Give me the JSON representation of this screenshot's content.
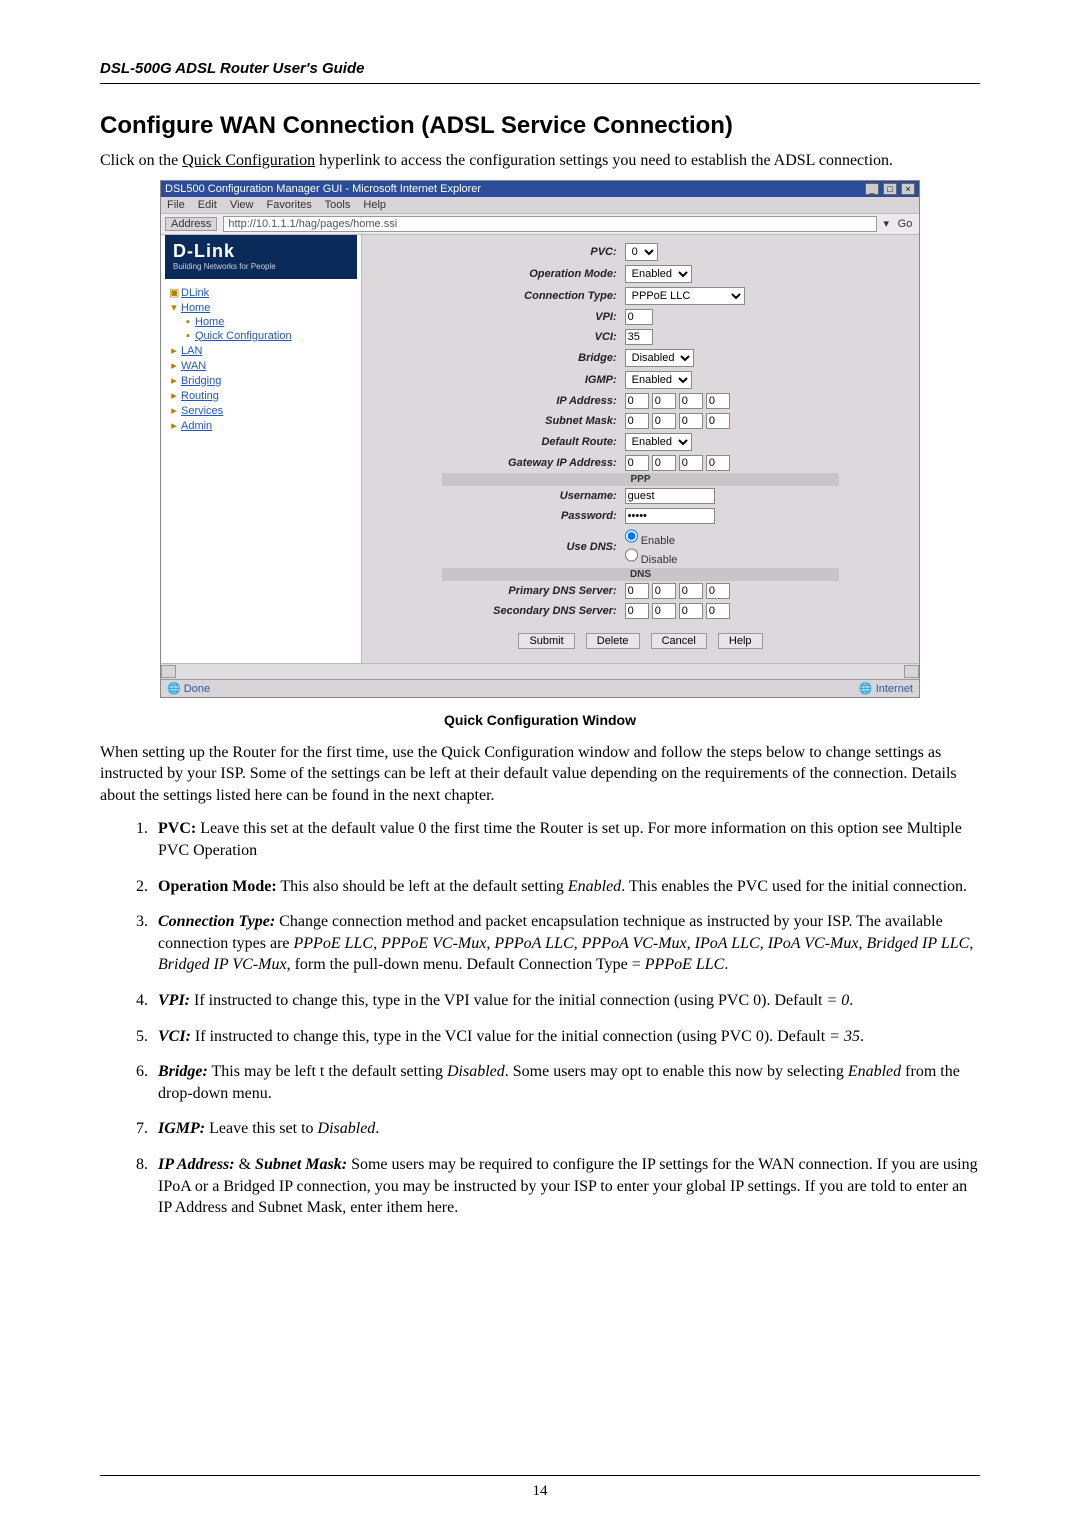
{
  "header": "DSL-500G ADSL Router User's Guide",
  "title": "Configure WAN Connection (ADSL Service Connection)",
  "intro_a": "Click on the ",
  "intro_link": "Quick Configuration",
  "intro_b": " hyperlink to access the configuration settings you need to establish the ADSL connection.",
  "screenshot": {
    "title": "DSL500 Configuration Manager GUI - Microsoft Internet Explorer",
    "menus": {
      "file": "File",
      "edit": "Edit",
      "view": "View",
      "favorites": "Favorites",
      "tools": "Tools",
      "help": "Help"
    },
    "address_label": "Address",
    "url": "http://10.1.1.1/hag/pages/home.ssi",
    "go": "Go",
    "brand": "D-Link",
    "brand_sub": "Building Networks for People",
    "tree": {
      "root": "DLink",
      "home": "Home",
      "home_sub": "Home",
      "quick": "Quick Configuration",
      "lan": "LAN",
      "wan": "WAN",
      "bridging": "Bridging",
      "routing": "Routing",
      "services": "Services",
      "admin": "Admin"
    },
    "form": {
      "pvc": {
        "label": "PVC:",
        "value": "0"
      },
      "opmode": {
        "label": "Operation Mode:",
        "value": "Enabled"
      },
      "ctype": {
        "label": "Connection Type:",
        "value": "PPPoE LLC"
      },
      "vpi": {
        "label": "VPI:",
        "value": "0"
      },
      "vci": {
        "label": "VCI:",
        "value": "35"
      },
      "bridge": {
        "label": "Bridge:",
        "value": "Disabled"
      },
      "igmp": {
        "label": "IGMP:",
        "value": "Enabled"
      },
      "ipaddr": {
        "label": "IP Address:",
        "a": "0",
        "b": "0",
        "c": "0",
        "d": "0"
      },
      "mask": {
        "label": "Subnet Mask:",
        "a": "0",
        "b": "0",
        "c": "0",
        "d": "0"
      },
      "droute": {
        "label": "Default Route:",
        "value": "Enabled"
      },
      "gwip": {
        "label": "Gateway IP Address:",
        "a": "0",
        "b": "0",
        "c": "0",
        "d": "0"
      },
      "ppp_section": "PPP",
      "user": {
        "label": "Username:",
        "value": "guest"
      },
      "pass": {
        "label": "Password:",
        "value": "*****"
      },
      "usedns": {
        "label": "Use DNS:",
        "enable": "Enable",
        "disable": "Disable"
      },
      "dns_section": "DNS",
      "pdns": {
        "label": "Primary DNS Server:",
        "a": "0",
        "b": "0",
        "c": "0",
        "d": "0"
      },
      "sdns": {
        "label": "Secondary DNS Server:",
        "a": "0",
        "b": "0",
        "c": "0",
        "d": "0"
      }
    },
    "buttons": {
      "submit": "Submit",
      "delete": "Delete",
      "cancel": "Cancel",
      "help": "Help"
    },
    "status_done": "Done",
    "status_zone": "Internet"
  },
  "caption": "Quick Configuration Window",
  "paragraph": "When setting up the Router for the first time, use the Quick Configuration window and follow the steps below to change settings as instructed by your ISP. Some of the settings can be left at their default value depending on the requirements of the connection. Details about the settings listed here can be found in the next chapter.",
  "steps": {
    "s1a": "PVC:",
    "s1b": " Leave this set at the default value 0 the first time the Router is set up. For more information on this option see Multiple PVC Operation",
    "s2a": "Operation Mode:",
    "s2b": " This also should be left at the default setting ",
    "s2c": "Enabled",
    "s2d": ". This enables the PVC used for the initial connection.",
    "s3a": "Connection Type:",
    "s3b": " Change connection method and packet encapsulation technique as instructed by your ISP. The available connection types are ",
    "s3c": "PPPoE LLC, PPPoE VC-Mux, PPPoA LLC, PPPoA VC-Mux, IPoA LLC, IPoA VC-Mux, Bridged IP LLC",
    "s3d": ", ",
    "s3e": "Bridged IP VC-Mux",
    "s3f": ", form the pull-down menu. Default Connection Type = ",
    "s3g": "PPPoE LLC",
    "s3h": ".",
    "s4a": "VPI:",
    "s4b": " If instructed to change this, type in the VPI value for the initial connection (using PVC 0). Default ",
    "s4c": "= 0",
    "s4d": ".",
    "s5a": "VCI:",
    "s5b": " If instructed to change this, type in the VCI value for the initial connection (using PVC 0). Default ",
    "s5c": "= 35",
    "s5d": ".",
    "s6a": "Bridge:",
    "s6b": " This may be left t the default setting ",
    "s6c": "Disabled",
    "s6d": ". Some users may opt to enable this now by selecting ",
    "s6e": "Enabled",
    "s6f": " from the drop-down menu.",
    "s7a": "IGMP:",
    "s7b": " Leave this set to ",
    "s7c": "Disabled",
    "s7d": ".",
    "s8a": "IP Address:",
    "s8amp": " & ",
    "s8b": "Subnet Mask:",
    "s8c": " Some users may be required to configure the IP settings for the WAN connection. If you are using IPoA or a Bridged IP connection, you may be instructed by your ISP to enter your global IP settings. If you are told to enter an IP Address and Subnet Mask, enter ithem here."
  },
  "page_number": "14"
}
